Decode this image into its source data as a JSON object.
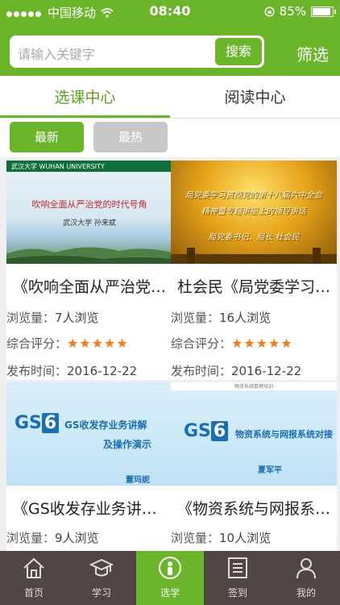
{
  "status_bar": {
    "carrier": "中国移动",
    "time": "08:40",
    "battery": "85%",
    "battery_level": 0.85
  },
  "search": {
    "placeholder": "请输入关键字",
    "button": "搜索"
  },
  "filter_label": "筛选",
  "tabs": [
    {
      "label": "选课中心",
      "active": true
    },
    {
      "label": "阅读中心",
      "active": false
    }
  ],
  "sort": [
    {
      "label": "最新",
      "active": true
    },
    {
      "label": "最热",
      "active": false
    }
  ],
  "labels": {
    "views": "浏览量：",
    "rating": "综合评分：",
    "published": "发布时间："
  },
  "courses": [
    {
      "title": "《吹响全面从严治党的时代号角》",
      "views": "7人浏览",
      "rating": 5,
      "date": "2016-12-22",
      "thumb": {
        "logo": "武汉大学  WUHAN UNIVERSITY",
        "headline": "吹响全面从严治党的时代号角",
        "author": "武汉大学 孙来斌"
      }
    },
    {
      "title": "杜会民《局党委学习贯彻党的十八届六中全会》",
      "views": "16人浏览",
      "rating": 5,
      "date": "2016-12-22",
      "thumb": {
        "line1": "局党委学习贯彻党的第十八届六中全会",
        "line2": "精神暨专题讲座上的领导讲话",
        "line3": "局党委书记、局长 杜会民"
      }
    },
    {
      "title": "《GS收发存业务讲解及操作演示》",
      "views": "9人浏览",
      "thumb": {
        "line1": "GS收发存业务讲解",
        "line2": "及操作演示",
        "sign": "董玛妮"
      }
    },
    {
      "title": "《物资系统与网报系统对接》",
      "views": "10人浏览",
      "thumb": {
        "header": "物资系统管理培训",
        "line1": "物资系统与网报系统对接",
        "sign": "夏军平"
      }
    }
  ],
  "bottom_nav": [
    {
      "label": "首页",
      "icon": "home-icon",
      "active": false
    },
    {
      "label": "学习",
      "icon": "graduation-cap-icon",
      "active": false
    },
    {
      "label": "选学",
      "icon": "person-icon",
      "active": true
    },
    {
      "label": "签到",
      "icon": "checklist-icon",
      "active": false
    },
    {
      "label": "我的",
      "icon": "user-icon",
      "active": false
    }
  ],
  "colors": {
    "brand": "#6ab52a",
    "nav_bg": "#4f4645",
    "star": "#f07a1c"
  }
}
